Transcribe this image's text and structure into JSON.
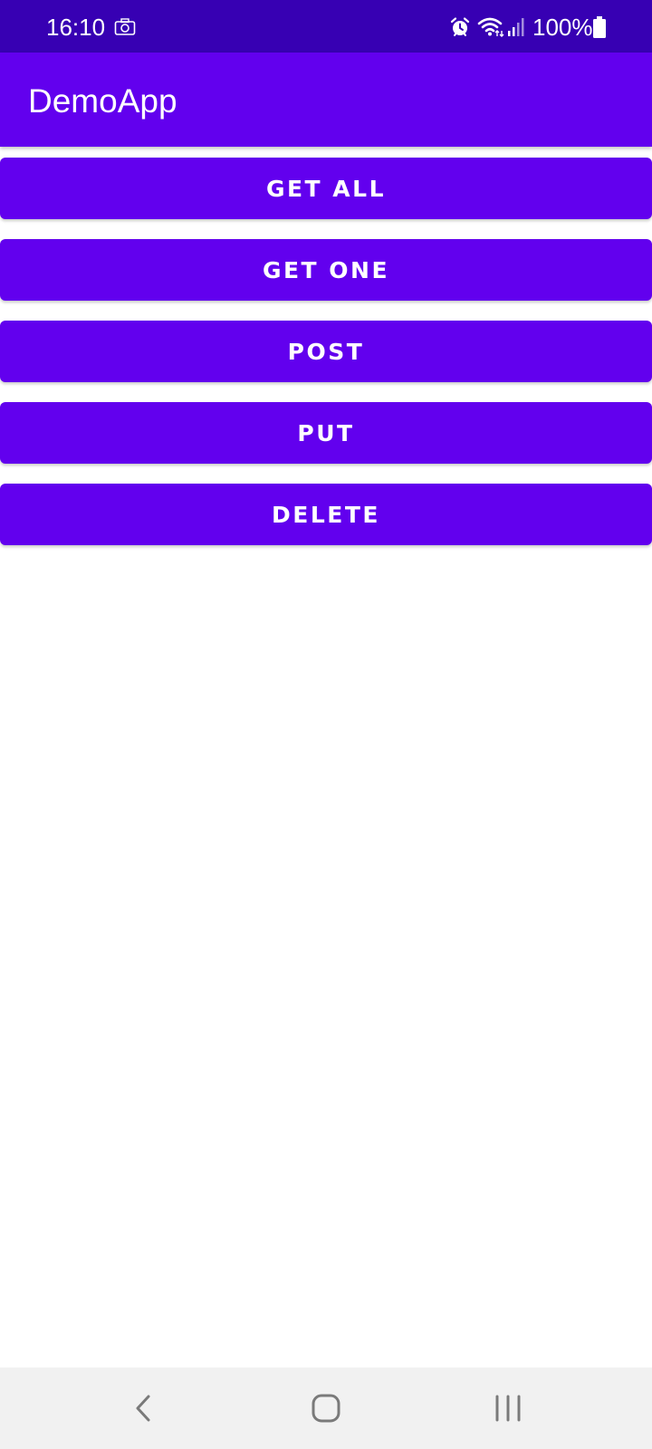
{
  "status_bar": {
    "time": "16:10",
    "battery_text": "100%",
    "icons": [
      "camera-icon",
      "alarm-icon",
      "wifi-icon",
      "signal-icon",
      "battery-icon"
    ]
  },
  "app_bar": {
    "title": "DemoApp"
  },
  "buttons": {
    "get_all": "GET ALL",
    "get_one": "GET ONE",
    "post": "POST",
    "put": "PUT",
    "delete": "DELETE"
  },
  "nav_bar": {
    "icons": [
      "back-icon",
      "home-icon",
      "recents-icon"
    ]
  },
  "colors": {
    "status_bar": "#3700B3",
    "primary": "#6200EE",
    "nav_bar": "#F1F1F1",
    "background": "#FFFFFF"
  }
}
